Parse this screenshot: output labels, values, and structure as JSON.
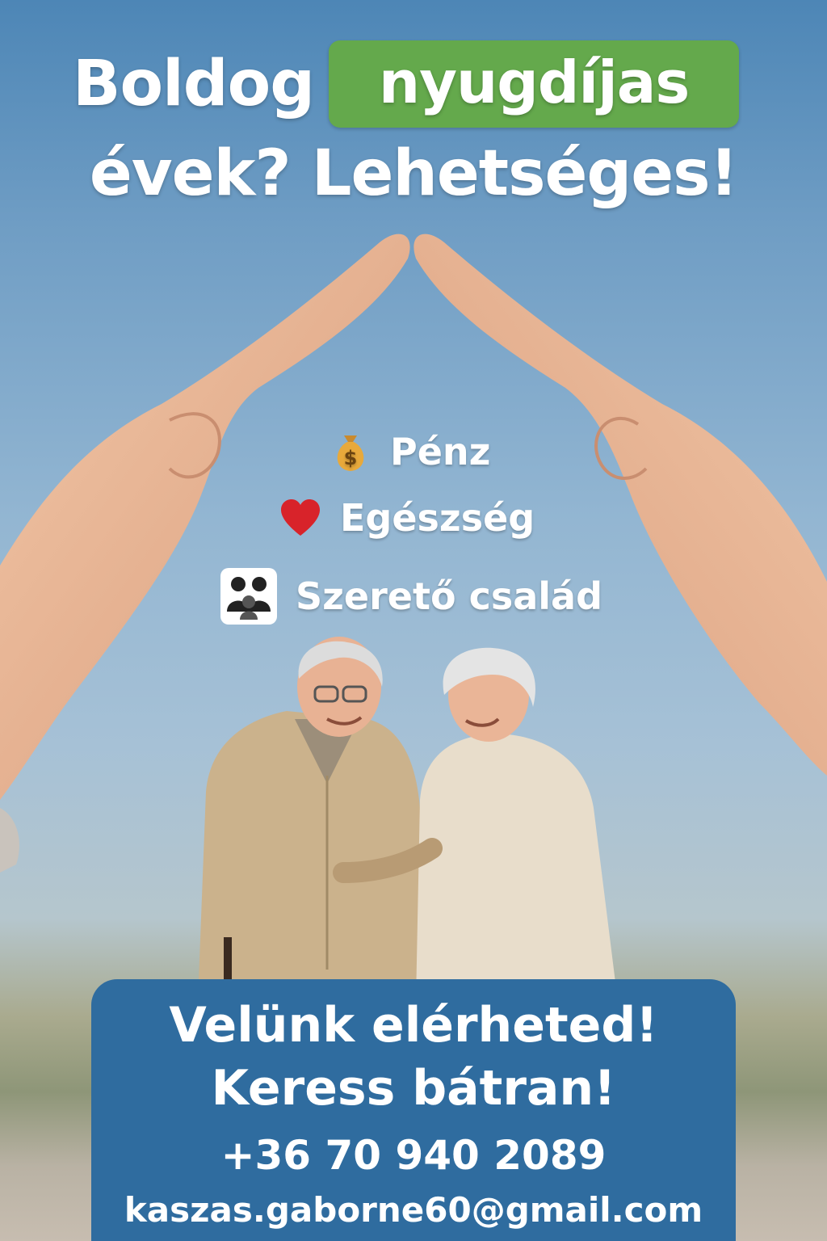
{
  "headline": {
    "word1": "Boldog",
    "highlight": "nyugdíjas",
    "line2": "évek? Lehetséges!"
  },
  "benefits": [
    {
      "icon": "money-bag-icon",
      "label": "Pénz"
    },
    {
      "icon": "heart-icon",
      "label": "Egészség"
    },
    {
      "icon": "family-icon",
      "label": "Szerető család"
    }
  ],
  "cta": {
    "line1": "Velünk elérheted!",
    "line2": "Keress bátran!",
    "phone": "+36 70 940 2089",
    "email": "kaszas.gaborne60@gmail.com"
  },
  "colors": {
    "sky_top": "#4d86b6",
    "highlight_green": "#64a94c",
    "cta_blue": "#2f6c9f",
    "text": "#ffffff"
  }
}
